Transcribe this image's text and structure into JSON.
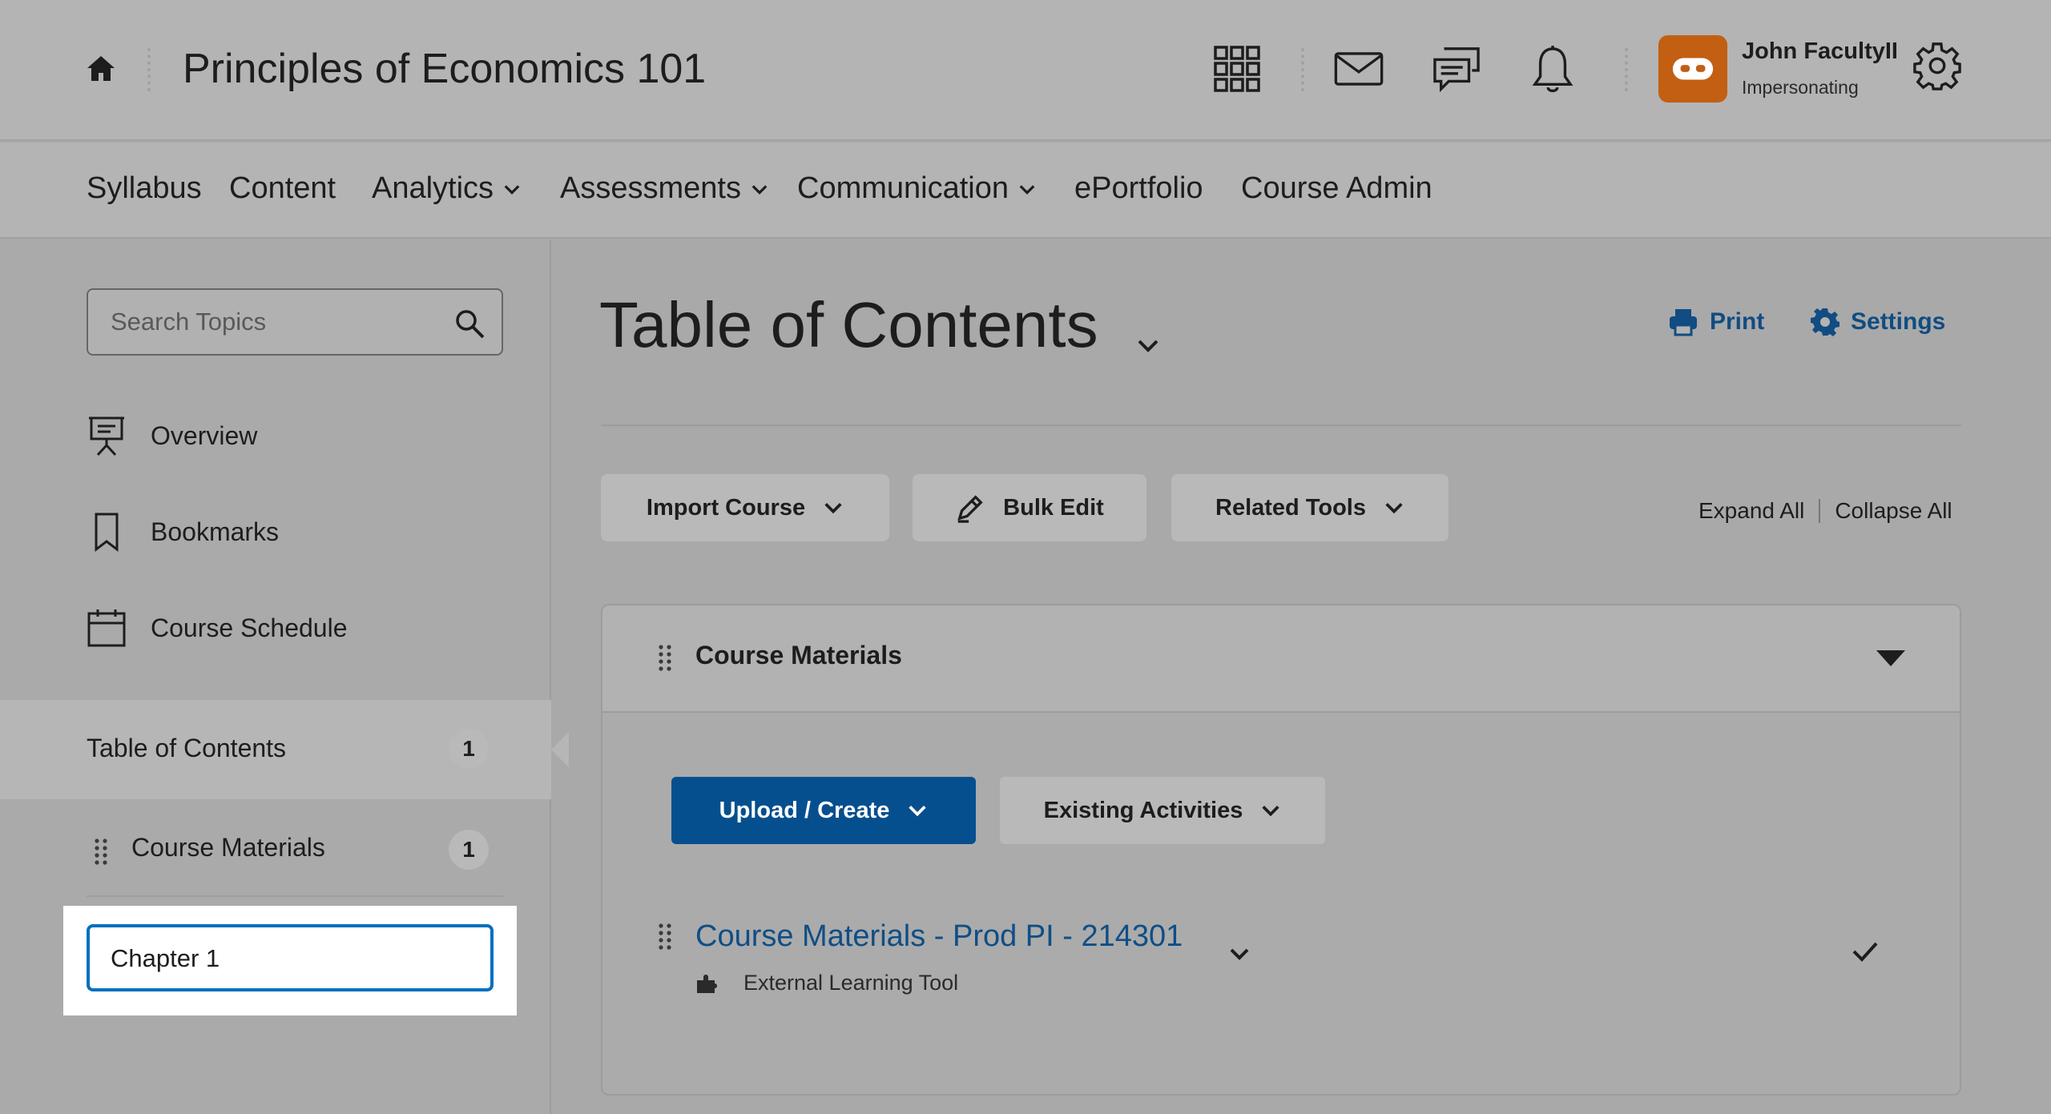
{
  "header": {
    "course_title": "Principles of Economics 101",
    "home_icon": "home-icon",
    "icons": [
      "apps-grid-icon",
      "mail-icon",
      "chat-icon",
      "bell-icon",
      "gear-icon"
    ],
    "user": {
      "name": "John FacultyII",
      "status": "Impersonating",
      "avatar_color": "#c25f12"
    }
  },
  "nav": {
    "items": [
      {
        "label": "Syllabus",
        "has_menu": false
      },
      {
        "label": "Content",
        "has_menu": false
      },
      {
        "label": "Analytics",
        "has_menu": true
      },
      {
        "label": "Assessments",
        "has_menu": true
      },
      {
        "label": "Communication",
        "has_menu": true
      },
      {
        "label": "ePortfolio",
        "has_menu": false
      },
      {
        "label": "Course Admin",
        "has_menu": false
      }
    ]
  },
  "sidebar": {
    "search_placeholder": "Search Topics",
    "links": [
      {
        "label": "Overview",
        "icon": "presentation-icon"
      },
      {
        "label": "Bookmarks",
        "icon": "bookmark-icon"
      },
      {
        "label": "Course Schedule",
        "icon": "calendar-icon"
      }
    ],
    "toc": {
      "label": "Table of Contents",
      "count": "1"
    },
    "modules": [
      {
        "label": "Course Materials",
        "count": "1"
      }
    ],
    "new_module_value": "Chapter 1"
  },
  "main": {
    "title": "Table of Contents",
    "print_label": "Print",
    "settings_label": "Settings",
    "toolbar": {
      "import_label": "Import Course",
      "bulk_edit_label": "Bulk Edit",
      "related_tools_label": "Related Tools"
    },
    "expand_all": "Expand All",
    "collapse_all": "Collapse All",
    "module": {
      "title": "Course Materials",
      "upload_label": "Upload / Create",
      "existing_label": "Existing Activities",
      "item": {
        "title": "Course Materials - Prod PI - 214301",
        "type": "External Learning Tool"
      }
    }
  },
  "colors": {
    "primary": "#064f8f",
    "link": "#0f4e86",
    "focus": "#006fbf",
    "brand": "#c25f12"
  }
}
